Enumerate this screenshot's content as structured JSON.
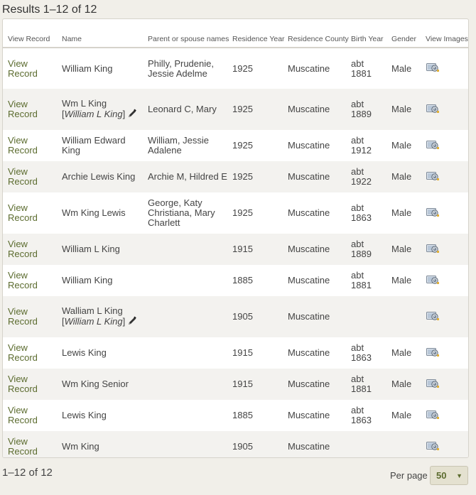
{
  "header": {
    "results_title": "Results 1–12 of 12"
  },
  "columns": {
    "view_record": "View Record",
    "name": "Name",
    "parent": "Parent or spouse names",
    "residence_year": "Residence Year",
    "residence_county": "Residence County",
    "birth_year": "Birth Year",
    "gender": "Gender",
    "view_images": "View Images"
  },
  "rows": [
    {
      "view": "View Record",
      "name": "William King",
      "alt": "",
      "parents": "Philly, Prudenie, Jessie Adelme",
      "year": "1925",
      "county": "Muscatine",
      "birth": "abt 1881",
      "gender": "Male"
    },
    {
      "view": "View Record",
      "name": "Wm L King",
      "alt": "William L King",
      "parents": "Leonard C, Mary",
      "year": "1925",
      "county": "Muscatine",
      "birth": "abt 1889",
      "gender": "Male"
    },
    {
      "view": "View Record",
      "name": "William Edward King",
      "alt": "",
      "parents": "William, Jessie Adalene",
      "year": "1925",
      "county": "Muscatine",
      "birth": "abt 1912",
      "gender": "Male"
    },
    {
      "view": "View Record",
      "name": "Archie Lewis King",
      "alt": "",
      "parents": "Archie M, Hildred E",
      "year": "1925",
      "county": "Muscatine",
      "birth": "abt 1922",
      "gender": "Male"
    },
    {
      "view": "View Record",
      "name": "Wm King Lewis",
      "alt": "",
      "parents": "George, Katy Christiana, Mary Charlett",
      "year": "1925",
      "county": "Muscatine",
      "birth": "abt 1863",
      "gender": "Male"
    },
    {
      "view": "View Record",
      "name": "William L King",
      "alt": "",
      "parents": "",
      "year": "1915",
      "county": "Muscatine",
      "birth": "abt 1889",
      "gender": "Male"
    },
    {
      "view": "View Record",
      "name": "William King",
      "alt": "",
      "parents": "",
      "year": "1885",
      "county": "Muscatine",
      "birth": "abt 1881",
      "gender": "Male"
    },
    {
      "view": "View Record",
      "name": "Walliam L King",
      "alt": "William L King",
      "parents": "",
      "year": "1905",
      "county": "Muscatine",
      "birth": "",
      "gender": ""
    },
    {
      "view": "View Record",
      "name": "Lewis King",
      "alt": "",
      "parents": "",
      "year": "1915",
      "county": "Muscatine",
      "birth": "abt 1863",
      "gender": "Male"
    },
    {
      "view": "View Record",
      "name": "Wm King Senior",
      "alt": "",
      "parents": "",
      "year": "1915",
      "county": "Muscatine",
      "birth": "abt 1881",
      "gender": "Male"
    },
    {
      "view": "View Record",
      "name": "Lewis King",
      "alt": "",
      "parents": "",
      "year": "1885",
      "county": "Muscatine",
      "birth": "abt 1863",
      "gender": "Male"
    },
    {
      "view": "View Record",
      "name": "Wm King",
      "alt": "",
      "parents": "",
      "year": "1905",
      "county": "Muscatine",
      "birth": "",
      "gender": ""
    }
  ],
  "footer": {
    "count": "1–12 of 12",
    "per_page_label": "Per page",
    "per_page_value": "50"
  },
  "icons": {
    "view_images": "camera-image-icon",
    "edit": "pencil-icon",
    "select": "caret-down-icon"
  },
  "colors": {
    "link": "#5b6b2e",
    "stripe": "#f3f2ef",
    "page_bg": "#f1efe9",
    "select_bg": "#e4e1d0"
  }
}
